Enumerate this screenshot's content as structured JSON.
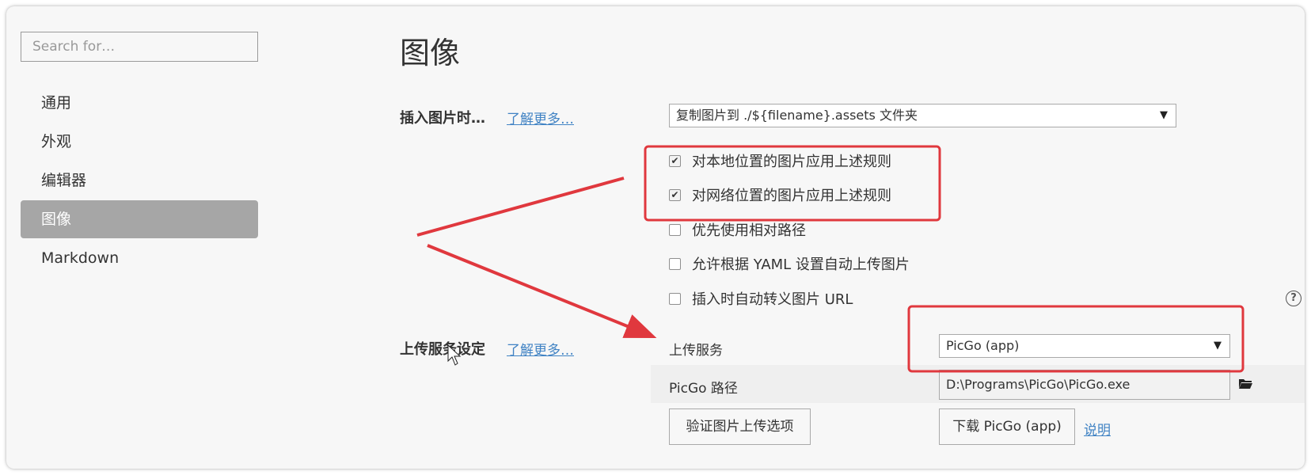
{
  "sidebar": {
    "search_placeholder": "Search for…",
    "items": [
      {
        "label": "通用"
      },
      {
        "label": "外观"
      },
      {
        "label": "编辑器"
      },
      {
        "label": "图像",
        "active": true
      },
      {
        "label": "Markdown"
      }
    ]
  },
  "main": {
    "title": "图像",
    "insert_section": {
      "label": "插入图片时…",
      "more_link": "了解更多…",
      "select_value": "复制图片到 ./${filename}.assets 文件夹"
    },
    "checkboxes": [
      {
        "label": "对本地位置的图片应用上述规则",
        "checked": true
      },
      {
        "label": "对网络位置的图片应用上述规则",
        "checked": true
      },
      {
        "label": "优先使用相对路径",
        "checked": false
      },
      {
        "label": "允许根据 YAML 设置自动上传图片",
        "checked": false
      },
      {
        "label": "插入时自动转义图片 URL",
        "checked": false
      }
    ],
    "upload_section": {
      "label": "上传服务设定",
      "more_link": "了解更多…",
      "service_label": "上传服务",
      "service_value": "PicGo (app)",
      "path_label": "PicGo 路径",
      "path_value": "D:\\Programs\\PicGo\\PicGo.exe",
      "verify_button": "验证图片上传选项",
      "download_button": "下载 PicGo (app)",
      "help_link": "说明"
    }
  },
  "icons": {
    "help": "question-circle-icon",
    "folder": "folder-open-icon",
    "caret": "caret-down-icon"
  },
  "colors": {
    "link": "#4183c4",
    "active_nav": "#a6a6a6",
    "annotation": "#e0383e"
  }
}
